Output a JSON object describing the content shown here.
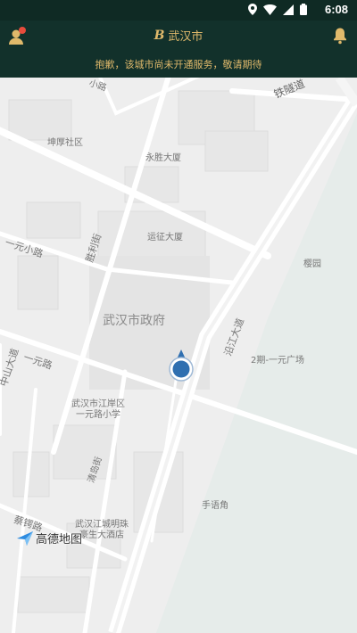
{
  "status_bar": {
    "time": "6:08",
    "icons": [
      "location-icon",
      "wifi-icon",
      "signal-icon",
      "battery-icon"
    ]
  },
  "header": {
    "city": "武汉市",
    "city_logo": "B",
    "notice": "抱歉，该城市尚未开通服务，敬请期待"
  },
  "map": {
    "labels": {
      "road_xiaolu": "小路",
      "tiesui": "铁隧道",
      "kunhou": "坤厚社区",
      "yongsheng": "永胜大厦",
      "yunzheng": "运征大厦",
      "shengli": "胜利街",
      "yiyuan_xiaolu": "一元小路",
      "yingyuan": "樱园",
      "govt": "武汉市政府",
      "yanjiang": "沿江大道",
      "plaza": "2期-一元广场",
      "yiyuanlu": "一元路",
      "zhongshan": "中山大道",
      "school": "武汉市江岸区\n一元路小学",
      "qingdao": "清岛街",
      "shouyu": "手语角",
      "caie": "蔡锷路",
      "hotel": "武汉江城明珠\n豪生大酒店"
    },
    "attribution": "高德地图"
  },
  "colors": {
    "header_bg": "#12312b",
    "accent": "#e0b96b",
    "marker": "#2f6fb0",
    "river": "#e6ecea"
  }
}
